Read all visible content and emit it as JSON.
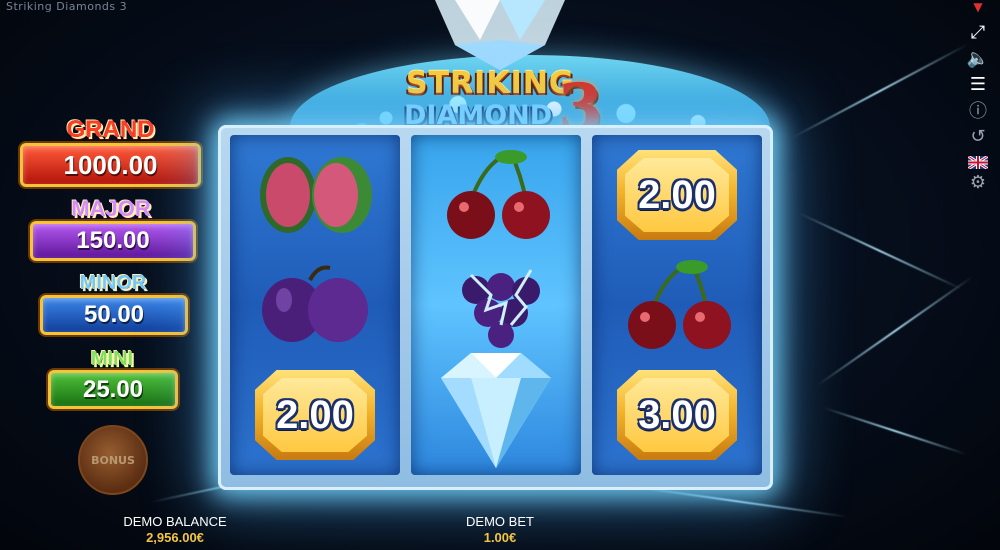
{
  "window": {
    "title": "Striking Diamonds 3"
  },
  "logo": {
    "line1": "STRIKING",
    "line2": "DIAMOND",
    "number": "3"
  },
  "jackpots": [
    {
      "name": "GRAND",
      "value": "1000.00"
    },
    {
      "name": "MAJOR",
      "value": "150.00"
    },
    {
      "name": "MINOR",
      "value": "50.00"
    },
    {
      "name": "MINI",
      "value": "25.00"
    }
  ],
  "bonus": {
    "label": "BONUS"
  },
  "reels": {
    "reel1": [
      "watermelon",
      "plum",
      "2.00"
    ],
    "reel2": [
      "cherry",
      "grapes",
      "diamond"
    ],
    "reel3": [
      "2.00",
      "cherry",
      "3.00"
    ]
  },
  "footer": {
    "balance_label": "DEMO BALANCE",
    "balance_value": "2,956.00€",
    "bet_label": "DEMO BET",
    "bet_value": "1.00€"
  },
  "toolbar": {
    "icons": [
      "fullscreen-icon",
      "sound-off-icon",
      "menu-icon",
      "info-icon",
      "history-icon",
      "language-flag-icon",
      "settings-icon"
    ]
  },
  "colors": {
    "accent_gold": "#f5c542",
    "frame_glow": "#78d7ff"
  }
}
